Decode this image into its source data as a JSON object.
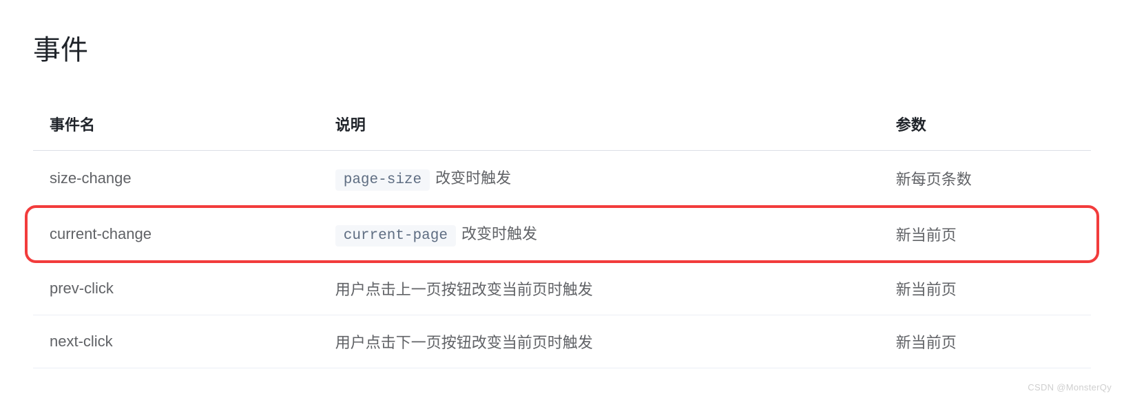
{
  "section_title": "事件",
  "table": {
    "headers": {
      "name": "事件名",
      "description": "说明",
      "params": "参数"
    },
    "rows": [
      {
        "name": "size-change",
        "desc_code": "page-size",
        "desc_text": "改变时触发",
        "params": "新每页条数",
        "highlighted": false
      },
      {
        "name": "current-change",
        "desc_code": "current-page",
        "desc_text": "改变时触发",
        "params": "新当前页",
        "highlighted": true
      },
      {
        "name": "prev-click",
        "desc_code": "",
        "desc_text": "用户点击上一页按钮改变当前页时触发",
        "params": "新当前页",
        "highlighted": false
      },
      {
        "name": "next-click",
        "desc_code": "",
        "desc_text": "用户点击下一页按钮改变当前页时触发",
        "params": "新当前页",
        "highlighted": false
      }
    ]
  },
  "watermark": "CSDN @MonsterQy"
}
